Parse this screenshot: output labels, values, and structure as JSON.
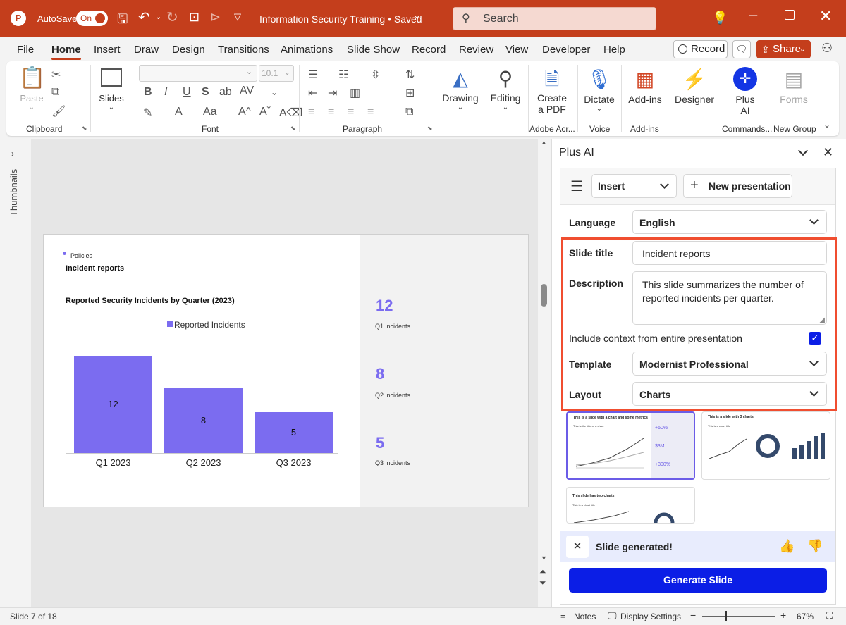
{
  "titlebar": {
    "autosave_label": "AutoSave",
    "toggle_label": "On",
    "doc_title": "Information Security Training • Saved",
    "search_placeholder": "Search"
  },
  "tabs": [
    "File",
    "Home",
    "Insert",
    "Draw",
    "Design",
    "Transitions",
    "Animations",
    "Slide Show",
    "Record",
    "Review",
    "View",
    "Developer",
    "Help"
  ],
  "record_button": "Record",
  "share_button": "Share",
  "ribbon": {
    "paste": "Paste",
    "clipboard": "Clipboard",
    "slides": "Slides",
    "font": "Font",
    "font_size": "10.1",
    "paragraph": "Paragraph",
    "drawing": "Drawing",
    "editing": "Editing",
    "create_pdf_1": "Create",
    "create_pdf_2": "a PDF",
    "adobe": "Adobe Acr...",
    "dictate": "Dictate",
    "voice": "Voice",
    "addins": "Add-ins",
    "addins_group": "Add-ins",
    "designer": "Designer",
    "plus_ai_1": "Plus",
    "plus_ai_2": "AI",
    "commands": "Commands...",
    "forms": "Forms",
    "new_group": "New Group"
  },
  "thumbnails_label": "Thumbnails",
  "slide": {
    "section": "Policies",
    "title": "Incident reports",
    "chart_title": "Reported Security Incidents by Quarter (2023)",
    "legend": "Reported Incidents",
    "metrics": [
      {
        "value": "12",
        "label": "Q1 incidents"
      },
      {
        "value": "8",
        "label": "Q2 incidents"
      },
      {
        "value": "5",
        "label": "Q3 incidents"
      }
    ]
  },
  "chart_data": {
    "type": "bar",
    "title": "Reported Security Incidents by Quarter (2023)",
    "categories": [
      "Q1 2023",
      "Q2 2023",
      "Q3 2023"
    ],
    "series": [
      {
        "name": "Reported Incidents",
        "values": [
          12,
          8,
          5
        ]
      }
    ],
    "ylim": [
      0,
      14
    ],
    "legend": "top",
    "grid": false,
    "color": "#7b6cf0"
  },
  "panel": {
    "title": "Plus AI",
    "insert": "Insert",
    "new_presentation": "New presentation",
    "language_label": "Language",
    "language_value": "English",
    "slide_title_label": "Slide title",
    "slide_title_value": "Incident reports",
    "description_label": "Description",
    "description_value": "This slide summarizes the number of reported incidents per quarter.",
    "context_label": "Include context from entire presentation",
    "template_label": "Template",
    "template_value": "Modernist Professional",
    "layout_label": "Layout",
    "layout_value": "Charts",
    "thumb1_title": "This is a slide with a chart and some metrics",
    "thumb1_sub": "This is the title of a chart",
    "thumb1_m1": "+50%",
    "thumb1_m2": "$3M",
    "thumb1_m3": "+300%",
    "thumb2_title": "This is a slide with 3 charts",
    "thumb2_sub": "This is a chart title",
    "thumb3_title": "This slide has two charts",
    "thumb3_sub": "This is a chart title",
    "generated": "Slide generated!",
    "generate_button": "Generate Slide"
  },
  "status": {
    "slide": "Slide 7 of 18",
    "notes": "Notes",
    "display": "Display Settings",
    "zoom": "67%"
  },
  "colors": {
    "brand": "#c43e1c",
    "bar": "#7b6cf0",
    "primary_button": "#0b1ee6",
    "highlight": "#f04e30"
  }
}
